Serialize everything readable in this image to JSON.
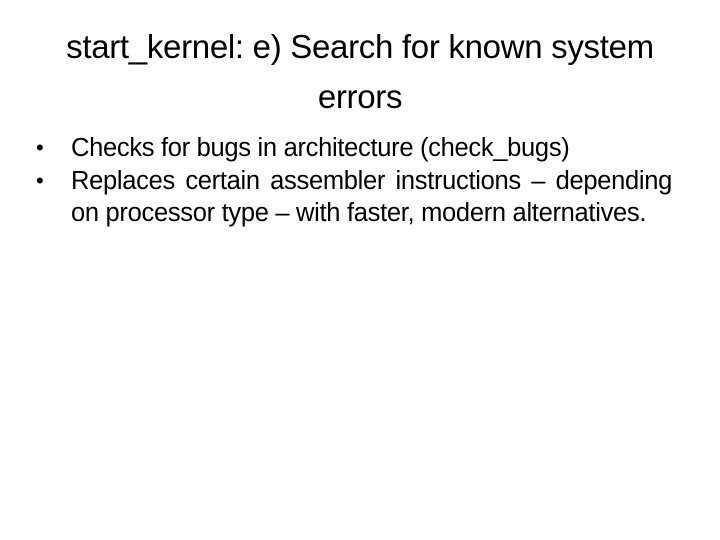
{
  "slide": {
    "title": "start_kernel: e) Search for known system errors",
    "bullets": [
      {
        "marker": "•",
        "text": "Checks for bugs in architecture (check_bugs)"
      },
      {
        "marker": "•",
        "text": "Replaces certain assembler instructions – depending on processor type – with faster, modern alternatives."
      }
    ]
  }
}
